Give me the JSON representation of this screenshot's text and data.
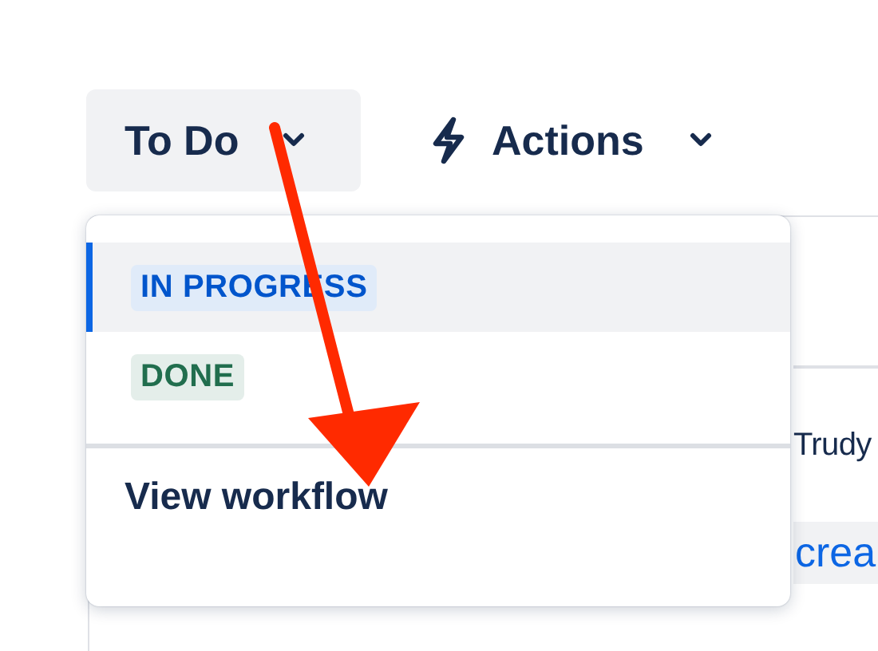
{
  "toolbar": {
    "status_button": {
      "label": "To Do",
      "expanded": true
    },
    "actions_button": {
      "label": "Actions"
    }
  },
  "status_menu": {
    "items": [
      {
        "kind": "status",
        "label": "IN PROGRESS",
        "color": "#0055cc",
        "selected": true
      },
      {
        "kind": "status",
        "label": "DONE",
        "color": "#216e4e",
        "selected": false
      },
      {
        "kind": "link",
        "label": "View workflow"
      }
    ]
  },
  "background": {
    "assignee": "Trudy",
    "link": "crea"
  },
  "annotation": {
    "kind": "arrow"
  }
}
